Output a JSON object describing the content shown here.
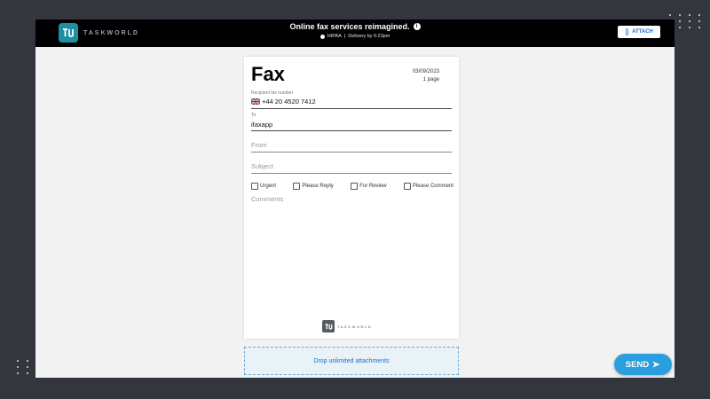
{
  "brand": {
    "name": "TASKWORLD"
  },
  "topbar": {
    "headline": "Online fax services reimagined.",
    "compliance": "HIPAA",
    "separator": "|",
    "delivery": "Delivery by 6:23pm",
    "attach_label": "ATTACH",
    "info_icon": "info-icon",
    "attach_icon": "paperclip-icon"
  },
  "fax": {
    "title": "Fax",
    "date": "03/09/2023",
    "pages": "1 page",
    "recipient_label": "Recipient fax number",
    "recipient_number": "+44 20 4520 7412",
    "recipient_flag": "uk-flag-icon",
    "to_label": "To",
    "to_value": "ifaxapp",
    "from_placeholder": "From",
    "subject_placeholder": "Subject",
    "checkboxes": [
      {
        "label": "Urgent",
        "checked": false
      },
      {
        "label": "Please Reply",
        "checked": false
      },
      {
        "label": "For Review",
        "checked": false
      },
      {
        "label": "Please Comment",
        "checked": false
      }
    ],
    "comments_placeholder": "Comments",
    "footer_brand": "TASKWORLD"
  },
  "dropzone": {
    "label": "Drop unlimited attachments"
  },
  "send": {
    "label": "SEND",
    "icon": "send-arrow-icon"
  },
  "colors": {
    "accent": "#2b9fdd",
    "brand_teal": "#1f8fa3",
    "link_blue": "#1b6fcf"
  }
}
